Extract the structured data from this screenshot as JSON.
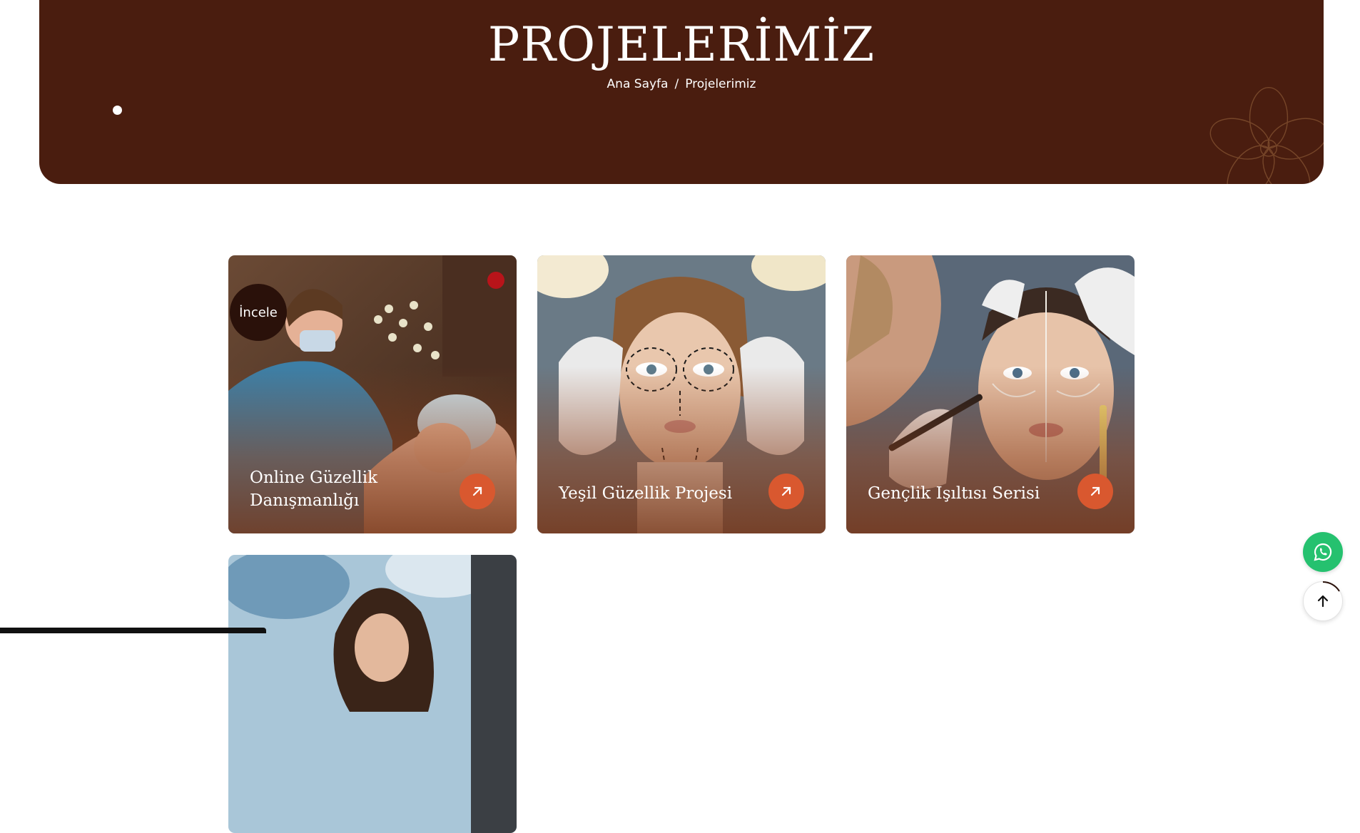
{
  "hero": {
    "title": "PROJELERİMİZ",
    "breadcrumb": {
      "home": "Ana Sayfa",
      "separator": "/",
      "current": "Projelerimiz"
    }
  },
  "cards": [
    {
      "title_line1": "Online Güzellik",
      "title_line2": "Danışmanlığı",
      "badge": "İncele"
    },
    {
      "title": "Yeşil Güzellik Projesi"
    },
    {
      "title": "Gençlik Işıltısı Serisi"
    },
    {
      "title": ""
    }
  ],
  "colors": {
    "hero_bg": "#4a1d0f",
    "accent": "#d9582f",
    "whatsapp": "#25c16f"
  },
  "icons": {
    "card_action": "arrow-up-right-icon",
    "whatsapp": "whatsapp-icon",
    "back_to_top": "arrow-up-icon"
  }
}
